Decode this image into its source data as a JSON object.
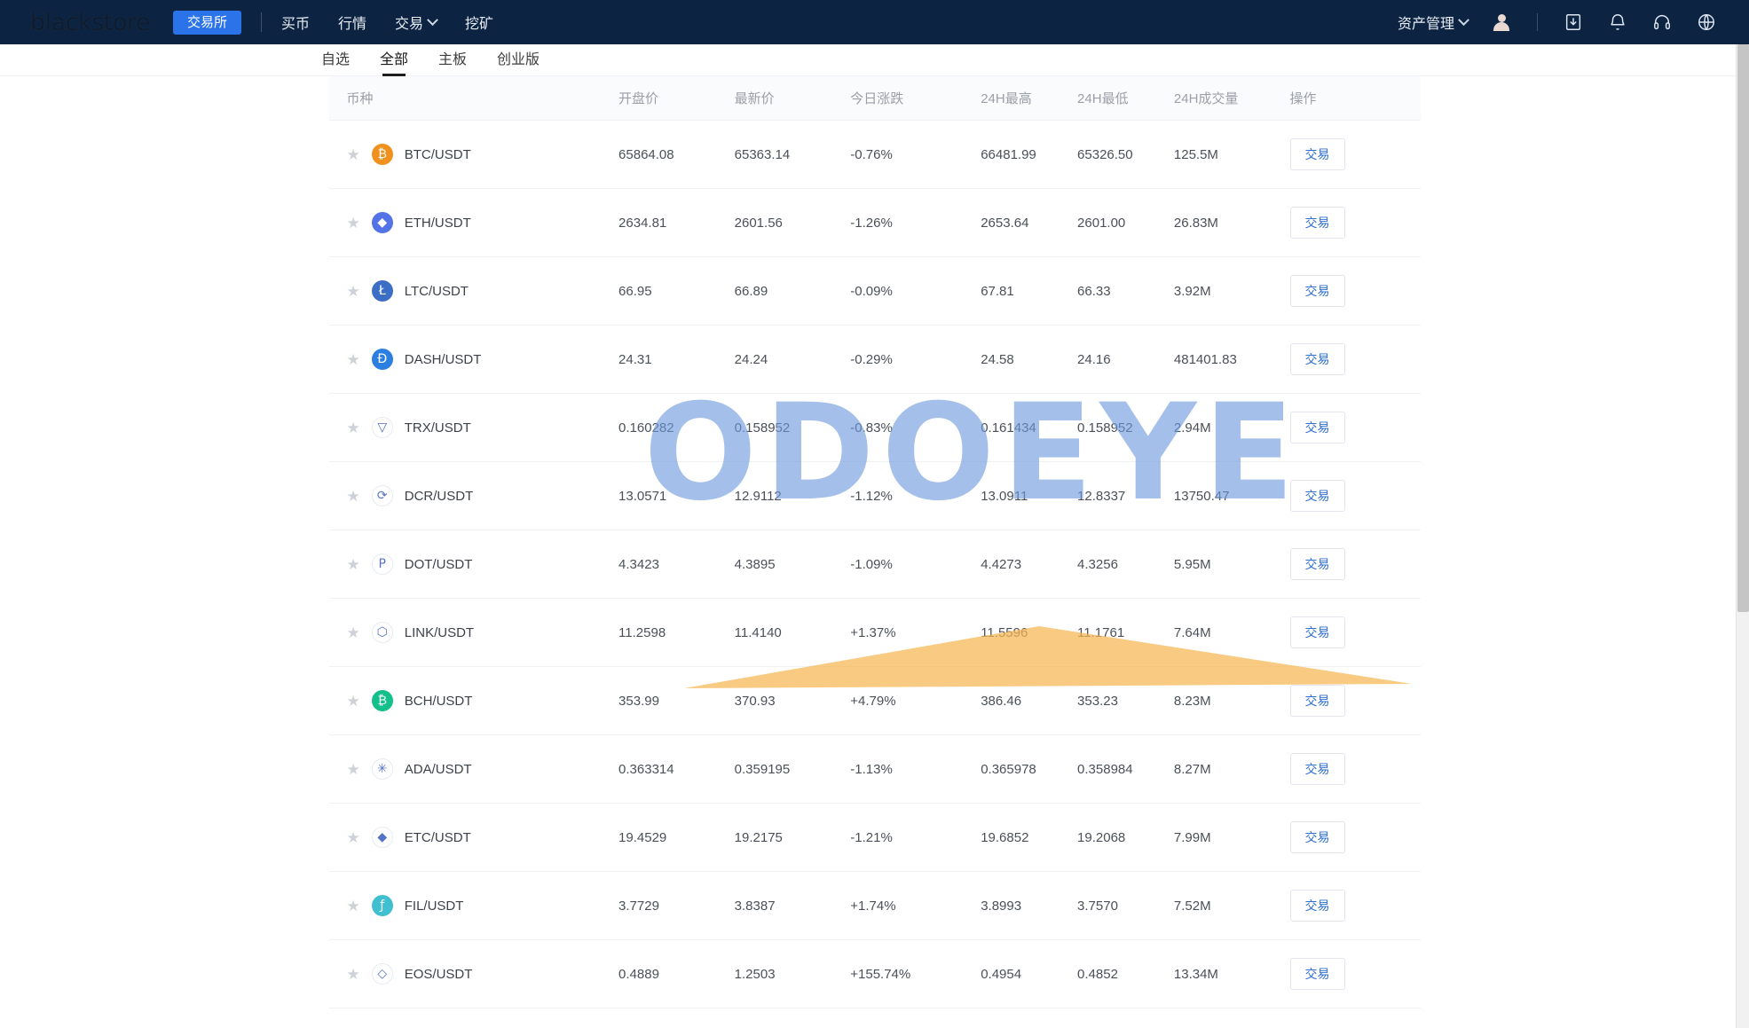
{
  "header": {
    "brand": "blackstore",
    "pill_label": "交易所",
    "nav": [
      {
        "label": "买币",
        "has_caret": false
      },
      {
        "label": "行情",
        "has_caret": false
      },
      {
        "label": "交易",
        "has_caret": true
      },
      {
        "label": "挖矿",
        "has_caret": false
      }
    ],
    "asset_menu": "资产管理",
    "icons": [
      "user-avatar-icon",
      "download-icon",
      "bell-icon",
      "headset-icon",
      "globe-icon"
    ]
  },
  "tabs": [
    {
      "label": "自选",
      "active": false
    },
    {
      "label": "全部",
      "active": true
    },
    {
      "label": "主板",
      "active": false
    },
    {
      "label": "创业版",
      "active": false
    }
  ],
  "table": {
    "columns": [
      "币种",
      "开盘价",
      "最新价",
      "今日涨跌",
      "24H最高",
      "24H最低",
      "24H成交量",
      "操作"
    ],
    "action_label": "交易",
    "star_glyph": "★",
    "rows": [
      {
        "symbol": "BTC/USDT",
        "icon_text": "₿",
        "icon_bg": "#f0911d",
        "open": "65864.08",
        "last": "65363.14",
        "change": "-0.76%",
        "dir": "down",
        "high": "66481.99",
        "low": "65326.50",
        "volume": "125.5M"
      },
      {
        "symbol": "ETH/USDT",
        "icon_text": "◆",
        "icon_bg": "#5373e7",
        "open": "2634.81",
        "last": "2601.56",
        "change": "-1.26%",
        "dir": "down",
        "high": "2653.64",
        "low": "2601.00",
        "volume": "26.83M"
      },
      {
        "symbol": "LTC/USDT",
        "icon_text": "Ł",
        "icon_bg": "#3b6ec4",
        "open": "66.95",
        "last": "66.89",
        "change": "-0.09%",
        "dir": "down",
        "high": "67.81",
        "low": "66.33",
        "volume": "3.92M"
      },
      {
        "symbol": "DASH/USDT",
        "icon_text": "Ð",
        "icon_bg": "#2a7fe0",
        "open": "24.31",
        "last": "24.24",
        "change": "-0.29%",
        "dir": "down",
        "high": "24.58",
        "low": "24.16",
        "volume": "481401.83"
      },
      {
        "symbol": "TRX/USDT",
        "icon_text": "▽",
        "icon_bg": "#ffffff",
        "open": "0.160282",
        "last": "0.158952",
        "change": "-0.83%",
        "dir": "down",
        "high": "0.161434",
        "low": "0.158952",
        "volume": "2.94M"
      },
      {
        "symbol": "DCR/USDT",
        "icon_text": "⟳",
        "icon_bg": "#ffffff",
        "open": "13.0571",
        "last": "12.9112",
        "change": "-1.12%",
        "dir": "down",
        "high": "13.0911",
        "low": "12.8337",
        "volume": "13750.47"
      },
      {
        "symbol": "DOT/USDT",
        "icon_text": "P",
        "icon_bg": "#ffffff",
        "open": "4.3423",
        "last": "4.3895",
        "change": "-1.09%",
        "dir": "down",
        "high": "4.4273",
        "low": "4.3256",
        "volume": "5.95M"
      },
      {
        "symbol": "LINK/USDT",
        "icon_text": "⬡",
        "icon_bg": "#ffffff",
        "open": "11.2598",
        "last": "11.4140",
        "change": "+1.37%",
        "dir": "up",
        "high": "11.5596",
        "low": "11.1761",
        "volume": "7.64M"
      },
      {
        "symbol": "BCH/USDT",
        "icon_text": "₿",
        "icon_bg": "#13c08a",
        "open": "353.99",
        "last": "370.93",
        "change": "+4.79%",
        "dir": "up",
        "high": "386.46",
        "low": "353.23",
        "volume": "8.23M"
      },
      {
        "symbol": "ADA/USDT",
        "icon_text": "✳",
        "icon_bg": "#ffffff",
        "open": "0.363314",
        "last": "0.359195",
        "change": "-1.13%",
        "dir": "down",
        "high": "0.365978",
        "low": "0.358984",
        "volume": "8.27M"
      },
      {
        "symbol": "ETC/USDT",
        "icon_text": "◆",
        "icon_bg": "#ffffff",
        "open": "19.4529",
        "last": "19.2175",
        "change": "-1.21%",
        "dir": "down",
        "high": "19.6852",
        "low": "19.2068",
        "volume": "7.99M"
      },
      {
        "symbol": "FIL/USDT",
        "icon_text": "ƒ",
        "icon_bg": "#3fbfcf",
        "open": "3.7729",
        "last": "3.8387",
        "change": "+1.74%",
        "dir": "up",
        "high": "3.8993",
        "low": "3.7570",
        "volume": "7.52M"
      },
      {
        "symbol": "EOS/USDT",
        "icon_text": "◇",
        "icon_bg": "#ffffff",
        "open": "0.4889",
        "last": "1.2503",
        "change": "+155.74%",
        "dir": "up",
        "high": "0.4954",
        "low": "0.4852",
        "volume": "13.34M"
      }
    ]
  },
  "watermark": {
    "text": "ODOEYE"
  },
  "colors": {
    "topbar_bg": "#0c2342",
    "accent_blue": "#2b73e8",
    "up_green": "#18a06a",
    "down_red": "#e0574d",
    "link_blue": "#2f6fd0"
  }
}
